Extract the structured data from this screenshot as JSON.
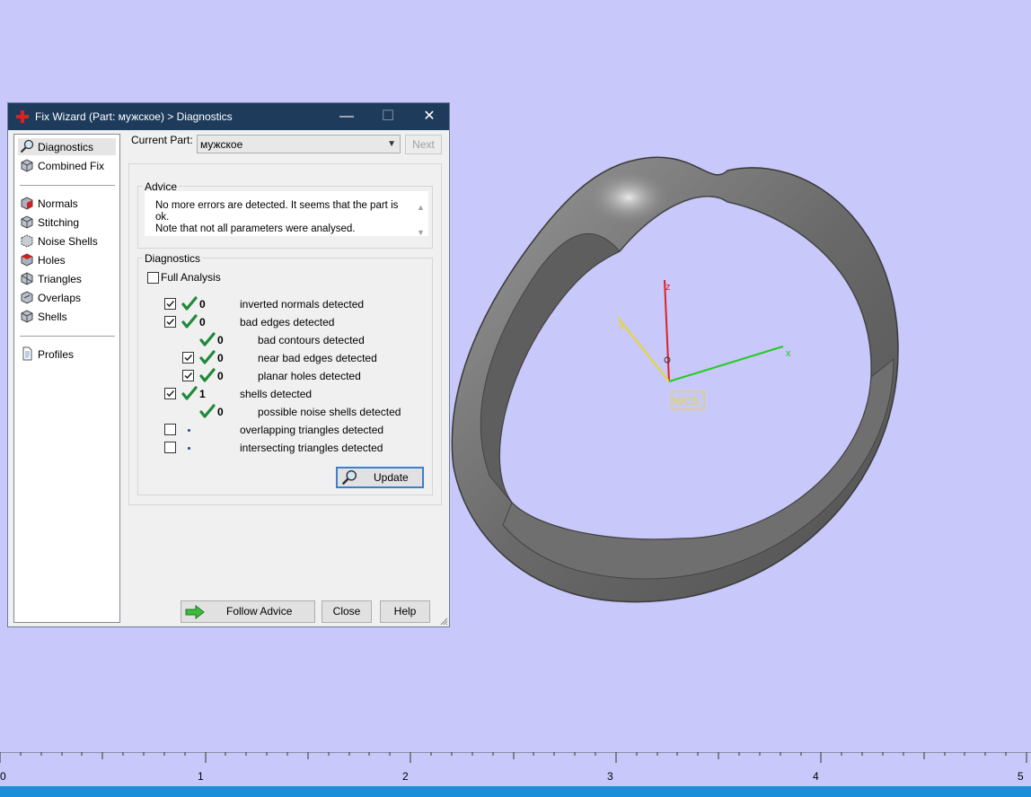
{
  "dialog": {
    "title": "Fix Wizard (Part: мужское) > Diagnostics",
    "min_glyph": "—",
    "max_glyph": "☐",
    "close_glyph": "✕"
  },
  "tree": {
    "items": [
      {
        "label": "Diagnostics",
        "icon": "magnifier-icon"
      },
      {
        "label": "Combined Fix",
        "icon": "cube-icon"
      },
      {
        "label": "Normals",
        "icon": "normals-icon"
      },
      {
        "label": "Stitching",
        "icon": "stitching-icon"
      },
      {
        "label": "Noise Shells",
        "icon": "noise-shells-icon"
      },
      {
        "label": "Holes",
        "icon": "holes-icon"
      },
      {
        "label": "Triangles",
        "icon": "triangles-icon"
      },
      {
        "label": "Overlaps",
        "icon": "overlaps-icon"
      },
      {
        "label": "Shells",
        "icon": "shells-icon"
      },
      {
        "label": "Profiles",
        "icon": "document-icon"
      }
    ]
  },
  "current_part": {
    "label": "Current Part:",
    "value": "мужское",
    "next_label": "Next"
  },
  "advice": {
    "title": "Advice",
    "line1": "No more errors are detected. It seems that the part is ok.",
    "line2": "Note that not all parameters were analysed."
  },
  "diagnostics": {
    "title": "Diagnostics",
    "full_analysis_label": "Full Analysis",
    "full_analysis_checked": false,
    "rows": [
      {
        "checked": true,
        "has_box": true,
        "status": "ok",
        "count": "0",
        "text": "inverted normals detected",
        "indent": 0
      },
      {
        "checked": true,
        "has_box": true,
        "status": "ok",
        "count": "0",
        "text": "bad edges detected",
        "indent": 0
      },
      {
        "checked": false,
        "has_box": false,
        "status": "ok",
        "count": "0",
        "text": "bad contours detected",
        "indent": 1
      },
      {
        "checked": true,
        "has_box": true,
        "status": "ok",
        "count": "0",
        "text": "near bad edges detected",
        "indent": 1
      },
      {
        "checked": true,
        "has_box": true,
        "status": "ok",
        "count": "0",
        "text": "planar holes detected",
        "indent": 1
      },
      {
        "checked": true,
        "has_box": true,
        "status": "ok",
        "count": "1",
        "text": "shells detected",
        "indent": 0
      },
      {
        "checked": false,
        "has_box": false,
        "status": "ok",
        "count": "0",
        "text": "possible noise shells detected",
        "indent": 1
      },
      {
        "checked": false,
        "has_box": true,
        "status": "pending",
        "count": "",
        "text": "overlapping triangles detected",
        "indent": 0
      },
      {
        "checked": false,
        "has_box": true,
        "status": "pending",
        "count": "",
        "text": "intersecting triangles detected",
        "indent": 0
      }
    ],
    "update_label": "Update"
  },
  "footer": {
    "follow_advice_label": "Follow Advice",
    "close_label": "Close",
    "help_label": "Help"
  },
  "viewport": {
    "axis_z": "z",
    "axis_y": "y",
    "axis_x": "x",
    "wcs_label": "WCS",
    "background": "#c8c8fa",
    "ruler_labels": [
      "0",
      "1",
      "2",
      "3",
      "4",
      "5"
    ]
  },
  "colors": {
    "titlebar": "#1e3b5c",
    "ok_check": "#1e8a3a",
    "axis_x": "#22cc22",
    "axis_y": "#e6d82a",
    "axis_z": "#dd2222"
  }
}
